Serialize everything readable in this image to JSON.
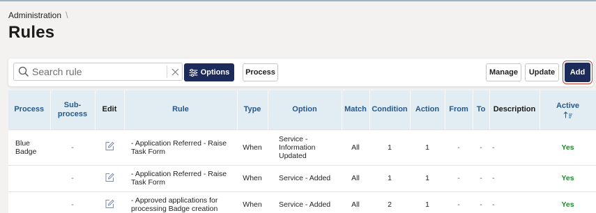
{
  "breadcrumb": {
    "parent": "Administration",
    "separator": "\\"
  },
  "page": {
    "title": "Rules"
  },
  "toolbar": {
    "search_placeholder": "Search rule",
    "search_value": "",
    "options_label": "Options",
    "process_label": "Process",
    "manage_label": "Manage",
    "update_label": "Update",
    "add_label": "Add"
  },
  "table": {
    "headers": {
      "process": "Process",
      "subprocess": "Sub-\nprocess",
      "edit": "Edit",
      "rule": "Rule",
      "type": "Type",
      "option": "Option",
      "match": "Match",
      "condition": "Condition",
      "action": "Action",
      "from": "From",
      "to": "To",
      "description": "Description",
      "active": "Active"
    },
    "rows": [
      {
        "process": "Blue\nBadge",
        "subprocess": "-",
        "rule": "- Application Referred - Raise Task Form",
        "type": "When",
        "option": "Service -\nInformation\nUpdated",
        "match": "All",
        "condition": "1",
        "action": "1",
        "from": "-",
        "to": "-",
        "description": "-",
        "active": "Yes"
      },
      {
        "process": "",
        "subprocess": "-",
        "rule": "- Application Referred - Raise Task Form",
        "type": "When",
        "option": "Service - Added",
        "match": "All",
        "condition": "1",
        "action": "1",
        "from": "-",
        "to": "-",
        "description": "-",
        "active": "Yes"
      },
      {
        "process": "",
        "subprocess": "-",
        "rule": "- Approved applications for processing Badge creation",
        "type": "When",
        "option": "Service - Added",
        "match": "All",
        "condition": "2",
        "action": "1",
        "from": "-",
        "to": "-",
        "description": "-",
        "active": "Yes"
      }
    ]
  },
  "colors": {
    "primary": "#1c2b5a",
    "header_bg": "#e2ecf3",
    "header_text": "#24598c",
    "active_yes": "#1e8a2c",
    "highlight_ring": "#c73b2f"
  },
  "icons": {
    "search": "search-icon",
    "clear": "close-icon",
    "options": "sliders-icon",
    "edit": "pencil-edit-icon",
    "sort": "sort-ascending-icon"
  }
}
